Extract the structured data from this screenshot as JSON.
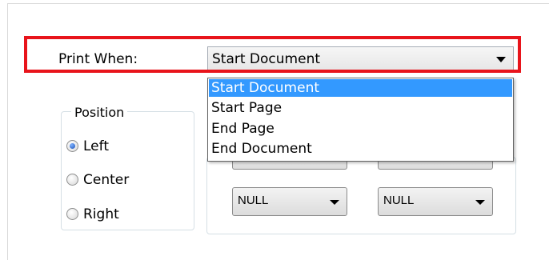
{
  "print_when": {
    "label": "Print When:",
    "selected": "Start Document",
    "options": [
      "Start Document",
      "Start Page",
      "End Page",
      "End Document"
    ]
  },
  "position": {
    "legend": "Position",
    "options": [
      {
        "label": "Left",
        "checked": true
      },
      {
        "label": "Center",
        "checked": false
      },
      {
        "label": "Right",
        "checked": false
      }
    ]
  },
  "null_combos": [
    "NULL",
    "NULL"
  ],
  "highlight_color": "#e8141b",
  "selection_color": "#3399ff"
}
